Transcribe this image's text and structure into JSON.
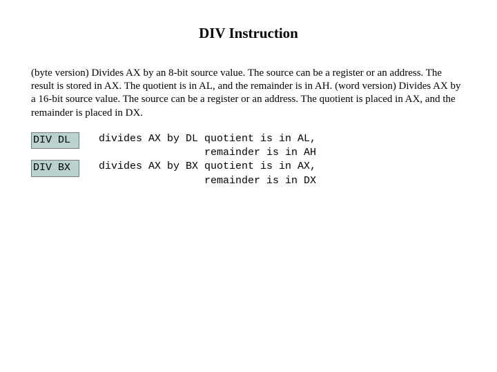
{
  "title": "DIV Instruction",
  "description": "(byte version) Divides AX by an 8-bit source value.  The source can be a register or an address.  The result is stored in AX.  The quotient is in AL, and the remainder is in AH. (word version) Divides AX by a 16-bit source value.  The source can be a register or an address.  The quotient is placed in AX, and the remainder is placed in DX.",
  "examples": [
    {
      "command": "DIV DL",
      "explain": "divides AX by DL quotient is in AL,\n                 remainder is in AH"
    },
    {
      "command": "DIV BX",
      "explain": "divides AX by BX quotient is in AX,\n                 remainder is in DX"
    }
  ]
}
